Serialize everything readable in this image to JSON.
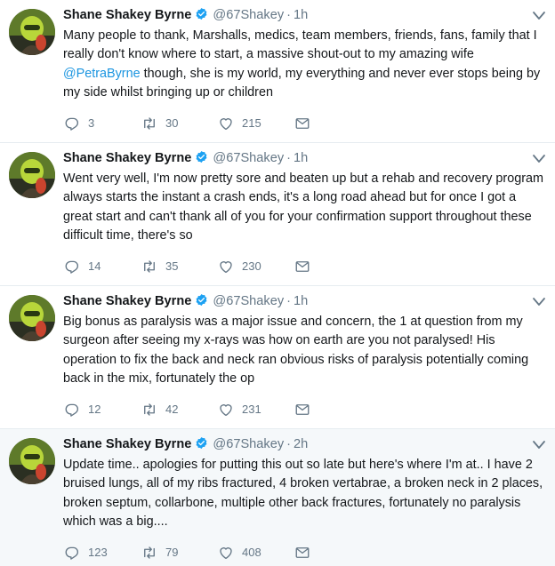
{
  "tweets": [
    {
      "name": "Shane Shakey Byrne",
      "handle": "@67Shakey",
      "dot": "·",
      "time": "1h",
      "text_before": "Many people to thank, Marshalls, medics, team members, friends, fans, family that I really don't know where to start, a massive shout-out to my amazing wife ",
      "mention": "@PetraByrne",
      "text_after": " though, she is my world, my everything and never ever stops being by my side whilst bringing up or children",
      "replies": "3",
      "retweets": "30",
      "likes": "215"
    },
    {
      "name": "Shane Shakey Byrne",
      "handle": "@67Shakey",
      "dot": "·",
      "time": "1h",
      "text_before": "Went very well, I'm now pretty sore and beaten up but a rehab and recovery program always starts the instant a crash ends, it's a long road ahead but for once I got a great start and can't thank all of you for your confirmation support throughout these difficult time, there's so",
      "mention": "",
      "text_after": "",
      "replies": "14",
      "retweets": "35",
      "likes": "230"
    },
    {
      "name": "Shane Shakey Byrne",
      "handle": "@67Shakey",
      "dot": "·",
      "time": "1h",
      "text_before": "Big bonus as paralysis was a major issue and concern, the 1 at question from my surgeon after seeing my x-rays was how on earth are you not paralysed! His operation to fix the back and neck ran obvious risks of paralysis potentially coming back in the mix, fortunately the op",
      "mention": "",
      "text_after": "",
      "replies": "12",
      "retweets": "42",
      "likes": "231"
    },
    {
      "name": "Shane Shakey Byrne",
      "handle": "@67Shakey",
      "dot": "·",
      "time": "2h",
      "text_before": "Update time.. apologies for putting this out so late but here's where I'm at.. I have 2 bruised lungs, all of my ribs fractured, 4 broken vertabrae, a broken neck in 2 places, broken septum, collarbone, multiple other back fractures, fortunately no paralysis which was a big....",
      "mention": "",
      "text_after": "",
      "replies": "123",
      "retweets": "79",
      "likes": "408"
    }
  ],
  "icons": {
    "verified": "verified-badge-icon",
    "caret": "chevron-down-icon",
    "reply": "reply-icon",
    "retweet": "retweet-icon",
    "like": "heart-icon",
    "dm": "envelope-icon"
  },
  "colors": {
    "verified": "#1da1f2",
    "mention": "#1b95e0",
    "muted": "#657786",
    "text": "#14171a"
  }
}
